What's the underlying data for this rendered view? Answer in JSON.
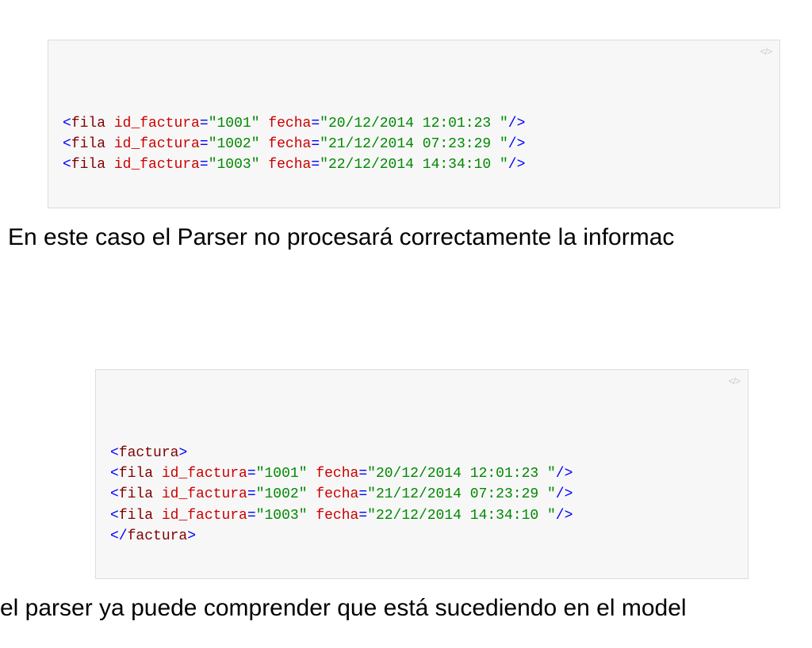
{
  "colors": {
    "tag": "#0000ff",
    "element": "#800000",
    "attr": "#cc0000",
    "value": "#008800",
    "border": "#dddddd",
    "code_bg": "#f7f7f7"
  },
  "text": {
    "paragraph1": "En este caso el Parser no procesará correctamente la informac",
    "paragraph2": "el parser ya puede comprender que está sucediendo en el model"
  },
  "code_blocks": [
    {
      "lines": [
        {
          "tag": "fila",
          "attrs": [
            {
              "name": "id_factura",
              "value": "1001"
            },
            {
              "name": "fecha",
              "value": "20/12/2014 12:01:23 "
            }
          ],
          "self_closing": true
        },
        {
          "tag": "fila",
          "attrs": [
            {
              "name": "id_factura",
              "value": "1002"
            },
            {
              "name": "fecha",
              "value": "21/12/2014 07:23:29 "
            }
          ],
          "self_closing": true
        },
        {
          "tag": "fila",
          "attrs": [
            {
              "name": "id_factura",
              "value": "1003"
            },
            {
              "name": "fecha",
              "value": "22/12/2014 14:34:10 "
            }
          ],
          "self_closing": true
        }
      ]
    },
    {
      "lines": [
        {
          "tag": "factura",
          "open": true
        },
        {
          "tag": "fila",
          "attrs": [
            {
              "name": "id_factura",
              "value": "1001"
            },
            {
              "name": "fecha",
              "value": "20/12/2014 12:01:23 "
            }
          ],
          "self_closing": true
        },
        {
          "tag": "fila",
          "attrs": [
            {
              "name": "id_factura",
              "value": "1002"
            },
            {
              "name": "fecha",
              "value": "21/12/2014 07:23:29 "
            }
          ],
          "self_closing": true
        },
        {
          "tag": "fila",
          "attrs": [
            {
              "name": "id_factura",
              "value": "1003"
            },
            {
              "name": "fecha",
              "value": "22/12/2014 14:34:10 "
            }
          ],
          "self_closing": true
        },
        {
          "tag": "factura",
          "close": true
        }
      ]
    }
  ]
}
